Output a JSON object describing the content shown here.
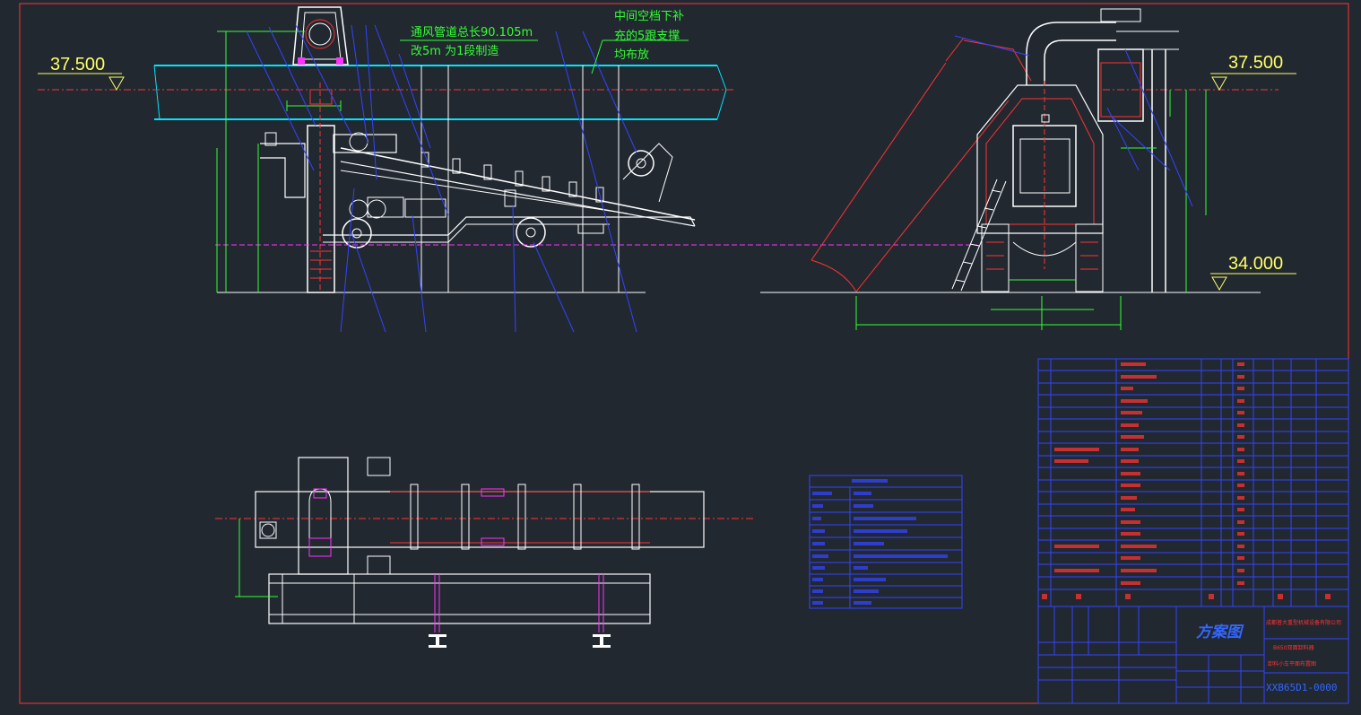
{
  "levels": {
    "top_left": "37.500",
    "top_right": "37.500",
    "bottom_right": "34.000"
  },
  "notes": {
    "duct_line1": "通风管道总长90.105m",
    "duct_line2": "改5m 为1段制造",
    "support_line1": "中间空档下补",
    "support_line2": "充的5跟支撑",
    "support_line3": "均布放"
  },
  "title_block": {
    "title": "方案图",
    "company": "成都普大重型机械设备有限公司",
    "product": "B650双面卸料器",
    "subtitle": "卸料小车平面布置图",
    "drawing_no": "XXB65D1-0000"
  },
  "colors": {
    "background": "#212830",
    "frame": "#ff3333",
    "dimension": "#33ff33",
    "leader": "#3344ff",
    "equipment": "#ffffff",
    "duct": "#00e5ff",
    "centerline": "#ff3333",
    "level_mark": "#ffff66",
    "rail_line": "#ff33ff"
  }
}
